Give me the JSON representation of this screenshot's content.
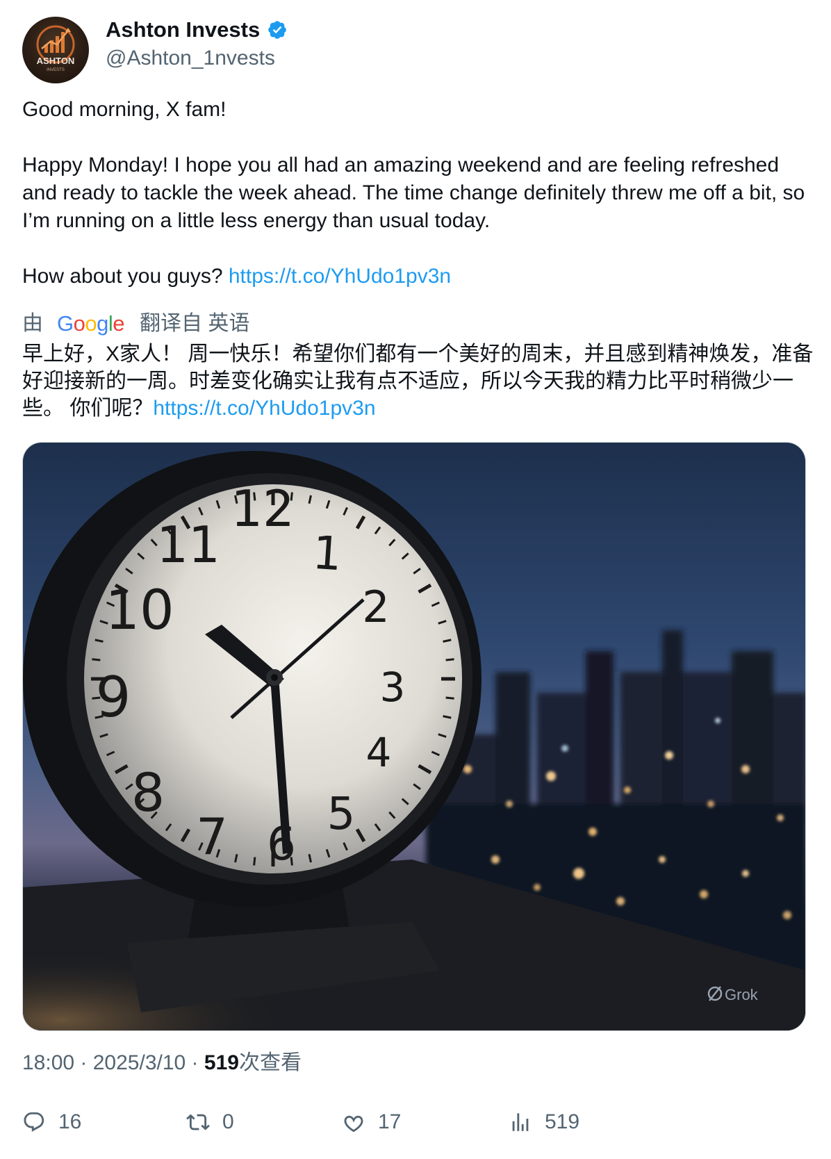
{
  "author": {
    "display_name": "Ashton Invests",
    "handle": "@Ashton_1nvests",
    "avatar_text": "ASHTON",
    "avatar_subtext": "INVESTS",
    "verified_icon": "verified-badge-icon",
    "verified_color": "#1d9bf0"
  },
  "tweet": {
    "para1": "Good morning, X fam!",
    "para2": "Happy Monday! I hope you all had an amazing weekend and are feeling refreshed and ready to tackle the week ahead. The time change definitely threw me off a bit, so I’m running on a little less energy than usual today.",
    "para3_text": "How about you guys? ",
    "link": "https://t.co/YhUdo1pv3n"
  },
  "translation": {
    "prefix": "由",
    "provider_letters": [
      "G",
      "o",
      "o",
      "g",
      "l",
      "e"
    ],
    "suffix": "翻译自 英语",
    "text": "早上好，X家人！ 周一快乐！希望你们都有一个美好的周末，并且感到精神焕发，准备好迎接新的一周。时差变化确实让我有点不适应，所以今天我的精力比平时稍微少一些。 你们呢？",
    "link": "https://t.co/YhUdo1pv3n"
  },
  "media": {
    "watermark": "Grok",
    "clock_numerals": [
      "12",
      "1",
      "2",
      "3",
      "4",
      "5",
      "6",
      "7",
      "8",
      "9",
      "10",
      "11"
    ]
  },
  "meta": {
    "time": "18:00",
    "separator": " · ",
    "date": "2025/3/10",
    "views_count": "519",
    "views_label": "次查看"
  },
  "actions": {
    "replies": "16",
    "reposts": "0",
    "likes": "17",
    "views": "519"
  },
  "colors": {
    "link": "#1d9bf0",
    "secondary_text": "#536471",
    "primary_text": "#0f1419"
  }
}
